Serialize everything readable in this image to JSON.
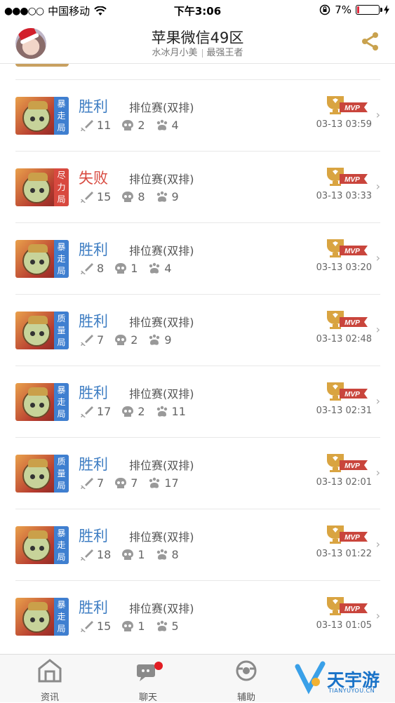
{
  "status_bar": {
    "carrier": "中国移动",
    "time": "下午3:06",
    "battery": "7%"
  },
  "header": {
    "title": "苹果微信49区",
    "subtitle_left": "水冰月小美",
    "subtitle_right": "最强王者"
  },
  "matches": [
    {
      "result": "胜利",
      "outcome": "win",
      "tag": [
        "暴",
        "走",
        "局"
      ],
      "tag_color": "#3f7fd0",
      "mode": "排位赛(双排)",
      "kills": "11",
      "deaths": "2",
      "assists": "4",
      "time": "03-13 03:59",
      "mvp": "MVP"
    },
    {
      "result": "失败",
      "outcome": "lose",
      "tag": [
        "尽",
        "力",
        "局"
      ],
      "tag_color": "#d8493f",
      "mode": "排位赛(双排)",
      "kills": "15",
      "deaths": "8",
      "assists": "9",
      "time": "03-13 03:33",
      "mvp": "MVP"
    },
    {
      "result": "胜利",
      "outcome": "win",
      "tag": [
        "暴",
        "走",
        "局"
      ],
      "tag_color": "#3f7fd0",
      "mode": "排位赛(双排)",
      "kills": "8",
      "deaths": "1",
      "assists": "4",
      "time": "03-13 03:20",
      "mvp": "MVP"
    },
    {
      "result": "胜利",
      "outcome": "win",
      "tag": [
        "质",
        "量",
        "局"
      ],
      "tag_color": "#3f7fd0",
      "mode": "排位赛(双排)",
      "kills": "7",
      "deaths": "2",
      "assists": "9",
      "time": "03-13 02:48",
      "mvp": "MVP"
    },
    {
      "result": "胜利",
      "outcome": "win",
      "tag": [
        "暴",
        "走",
        "局"
      ],
      "tag_color": "#3f7fd0",
      "mode": "排位赛(双排)",
      "kills": "17",
      "deaths": "2",
      "assists": "11",
      "time": "03-13 02:31",
      "mvp": "MVP"
    },
    {
      "result": "胜利",
      "outcome": "win",
      "tag": [
        "质",
        "量",
        "局"
      ],
      "tag_color": "#3f7fd0",
      "mode": "排位赛(双排)",
      "kills": "7",
      "deaths": "7",
      "assists": "17",
      "time": "03-13 02:01",
      "mvp": "MVP"
    },
    {
      "result": "胜利",
      "outcome": "win",
      "tag": [
        "暴",
        "走",
        "局"
      ],
      "tag_color": "#3f7fd0",
      "mode": "排位赛(双排)",
      "kills": "18",
      "deaths": "1",
      "assists": "8",
      "time": "03-13 01:22",
      "mvp": "MVP"
    },
    {
      "result": "胜利",
      "outcome": "win",
      "tag": [
        "暴",
        "走",
        "局"
      ],
      "tag_color": "#3f7fd0",
      "mode": "排位赛(双排)",
      "kills": "15",
      "deaths": "1",
      "assists": "5",
      "time": "03-13 01:05",
      "mvp": "MVP"
    }
  ],
  "tabbar": {
    "news": "资讯",
    "chat": "聊天",
    "assist": "辅助"
  },
  "watermark": {
    "text": "天宇游",
    "url": "TIANYUYOU.CN"
  },
  "colors": {
    "win": "#3f7ec3",
    "lose": "#d8493f",
    "mvp_gold": "#d9a441"
  }
}
